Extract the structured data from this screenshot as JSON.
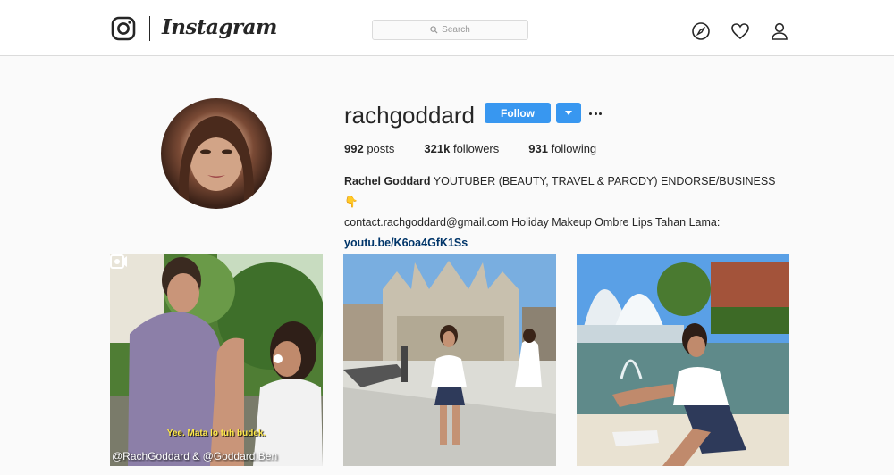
{
  "nav": {
    "logo_text": "Instagram",
    "search_placeholder": "Search",
    "icons": [
      "instagram-logo-icon",
      "search-icon",
      "compass-icon",
      "heart-icon",
      "user-icon"
    ]
  },
  "profile": {
    "username": "rachgoddard",
    "follow_label": "Follow",
    "stats": {
      "posts_count": "992",
      "posts_label": "posts",
      "followers_count": "321k",
      "followers_label": "followers",
      "following_count": "931",
      "following_label": "following"
    },
    "bio": {
      "full_name": "Rachel Goddard",
      "text_line1": " YOUTUBER (BEAUTY, TRAVEL & PARODY) ENDORSE/BUSINESS 👇",
      "text_line2": "contact.rachgoddard@gmail.com Holiday Makeup Ombre Lips Tahan Lama:",
      "link": "youtu.be/K6oa4GfK1Ss"
    }
  },
  "posts": [
    {
      "type": "video",
      "subtitle": "Yee. Mata lo tuh budek.",
      "watermark": "@RachGoddard & @Goddard.Ben"
    },
    {
      "type": "photo"
    },
    {
      "type": "photo"
    }
  ],
  "colors": {
    "accent": "#3897f0",
    "link": "#003569",
    "background": "#fafafa"
  }
}
